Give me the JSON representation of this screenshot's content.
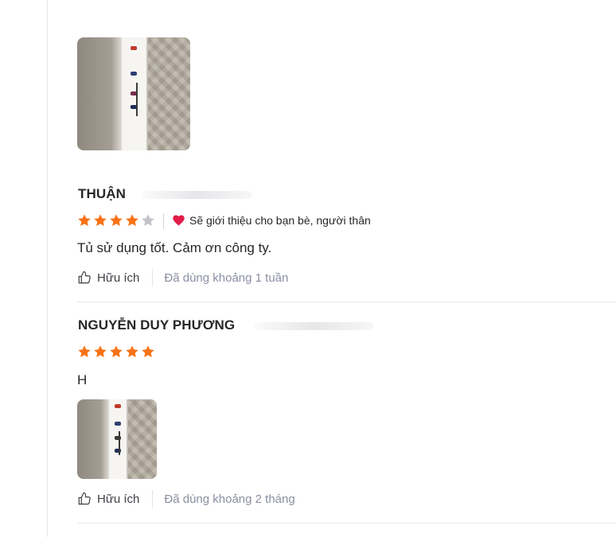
{
  "colors": {
    "star_filled": "#f97316",
    "star_empty": "#c4c4c8",
    "heart": "#e11d48",
    "muted_text": "#8b8fa3"
  },
  "reviews": [
    {
      "author": "THUẬN",
      "rating": 4,
      "max_rating": 5,
      "recommend_icon": "heart-icon",
      "recommend_text": "Sẽ giới thiệu cho bạn bè, người thân",
      "text": "Tủ sử dụng tốt. Cảm ơn công ty.",
      "helpful_icon": "thumbs-up-icon",
      "helpful_label": "Hữu ích",
      "usage": "Đã dùng khoảng 1 tuần"
    },
    {
      "author": "NGUYỄN DUY PHƯƠNG",
      "rating": 5,
      "max_rating": 5,
      "text": "H",
      "helpful_icon": "thumbs-up-icon",
      "helpful_label": "Hữu ích",
      "usage": "Đã dùng khoảng 2 tháng"
    }
  ]
}
